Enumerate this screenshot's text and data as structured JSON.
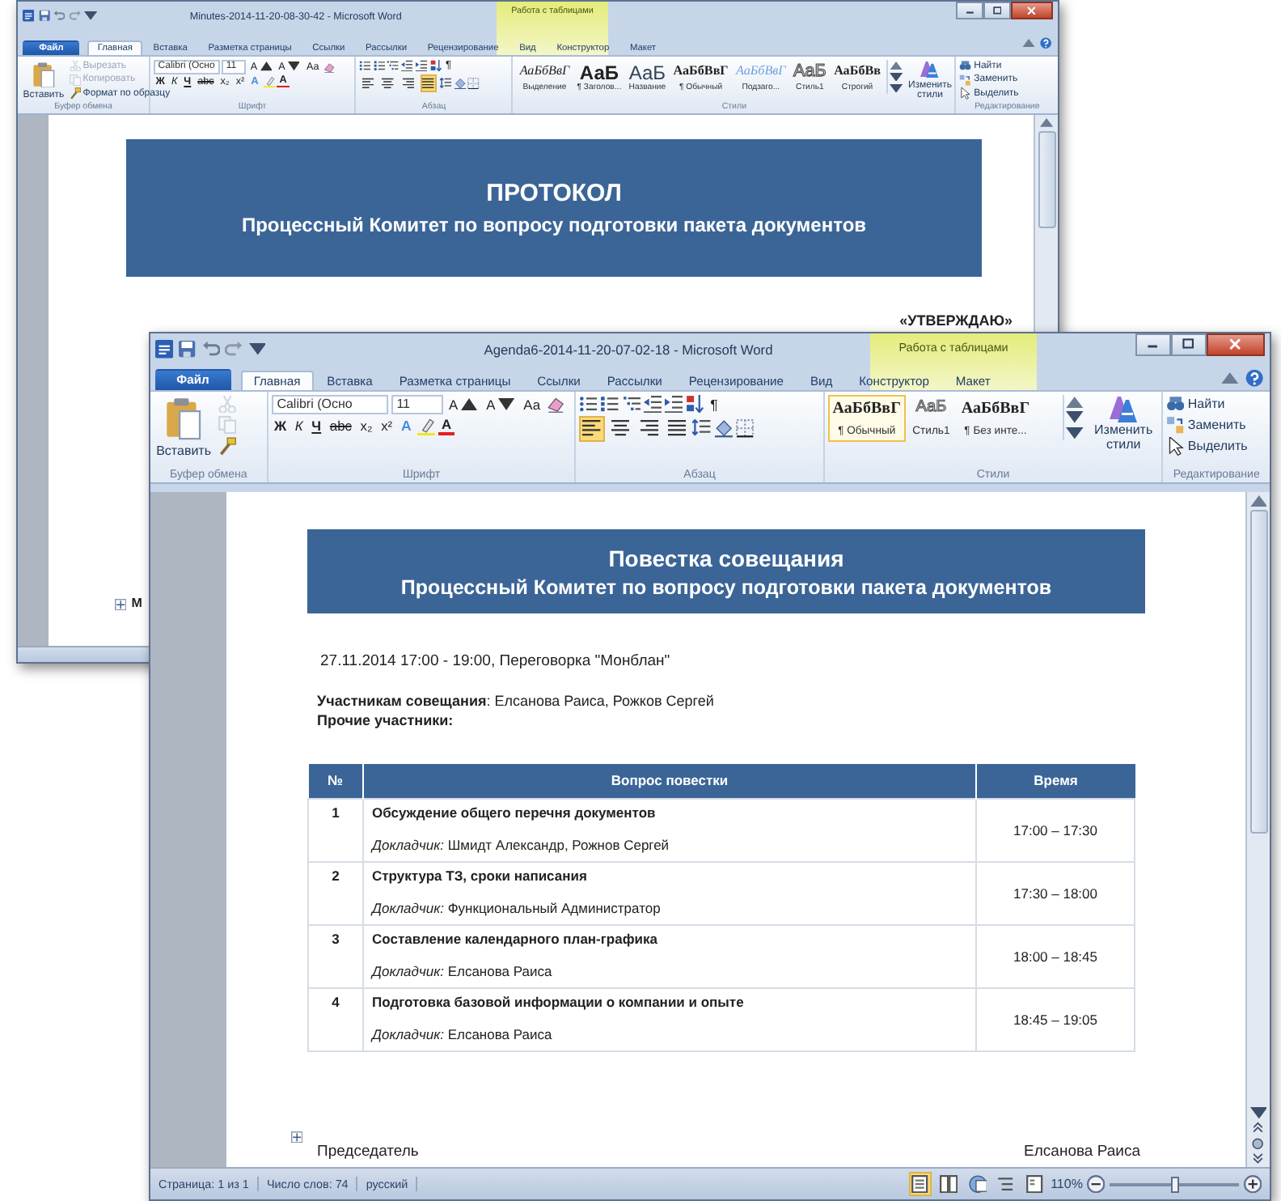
{
  "windows": [
    {
      "kind": "back",
      "title": "Minutes-2014-11-20-08-30-42 - Microsoft Word",
      "context_tab": "Работа с таблицами",
      "tabs": [
        {
          "label": "Файл",
          "kind": "file",
          "selected": false
        },
        {
          "label": "Главная",
          "kind": "tab",
          "selected": true
        },
        {
          "label": "Вставка",
          "kind": "tab",
          "selected": false
        },
        {
          "label": "Разметка страницы",
          "kind": "tab",
          "selected": false
        },
        {
          "label": "Ссылки",
          "kind": "tab",
          "selected": false
        },
        {
          "label": "Рассылки",
          "kind": "tab",
          "selected": false
        },
        {
          "label": "Рецензирование",
          "kind": "tab",
          "selected": false
        },
        {
          "label": "Вид",
          "kind": "tab",
          "selected": false
        },
        {
          "label": "Конструктор",
          "kind": "tab",
          "selected": false
        },
        {
          "label": "Макет",
          "kind": "tab",
          "selected": false
        }
      ],
      "ribbon": [
        {
          "kind": "clipboard",
          "label": "Буфер обмена",
          "paste": "Вставить",
          "small": [
            {
              "label": "Вырезать",
              "disabled": true
            },
            {
              "label": "Копировать",
              "disabled": true
            },
            {
              "label": "Формат по образцу",
              "disabled": false
            }
          ]
        },
        {
          "kind": "font",
          "label": "Шрифт",
          "font": "Calibri (Осно",
          "size": "11",
          "grow": "A",
          "shrink": "A",
          "case": "Аа",
          "format": [
            {
              "text": "Ж",
              "kind": "bold"
            },
            {
              "text": "К",
              "kind": "italic"
            },
            {
              "text": "Ч",
              "kind": "underline"
            },
            {
              "text": "abc",
              "kind": "strike"
            },
            {
              "text": "x₂",
              "kind": "sub"
            },
            {
              "text": "x²",
              "kind": "sup"
            }
          ],
          "effects": "A",
          "color_letter": "A"
        },
        {
          "kind": "paragraph",
          "label": "Абзац",
          "pilcrow": "¶",
          "align": [
            {
              "selected": false
            },
            {
              "selected": false
            },
            {
              "selected": false
            },
            {
              "selected": true
            }
          ]
        },
        {
          "kind": "styles",
          "label": "Стили",
          "change": "Изменить стили",
          "styles": [
            {
              "sample": "АаБбВвГ",
              "label": "Выделение",
              "kind": "italic",
              "selected": false
            },
            {
              "sample": "АаБ",
              "label": "¶ Заголов...",
              "kind": "heading",
              "selected": false
            },
            {
              "sample": "АаБ",
              "label": "Название",
              "kind": "title",
              "selected": false
            },
            {
              "sample": "АаБбВвГ",
              "label": "¶ Обычный",
              "kind": "serif",
              "selected": false
            },
            {
              "sample": "АаБбВвГ",
              "label": "Подзаго...",
              "kind": "subtle",
              "selected": false
            },
            {
              "sample": "АаБ",
              "label": "Стиль1",
              "kind": "outline",
              "selected": false
            },
            {
              "sample": "АаБбВв",
              "label": "Строгий",
              "kind": "strong",
              "selected": false
            }
          ]
        },
        {
          "kind": "editing",
          "label": "Редактирование",
          "items": [
            "Найти",
            "Заменить",
            "Выделить"
          ]
        }
      ],
      "document": {
        "banner": {
          "title": "ПРОТОКОЛ",
          "subtitle": "Процессный Комитет по вопросу подготовки пакета документов"
        },
        "approval": "«УТВЕРЖДАЮ»",
        "fragment": "М"
      }
    },
    {
      "kind": "front",
      "title": "Agenda6-2014-11-20-07-02-18 - Microsoft Word",
      "context_tab": "Работа с таблицами",
      "tabs": [
        {
          "label": "Файл",
          "kind": "file",
          "selected": false
        },
        {
          "label": "Главная",
          "kind": "tab",
          "selected": true
        },
        {
          "label": "Вставка",
          "kind": "tab",
          "selected": false
        },
        {
          "label": "Разметка страницы",
          "kind": "tab",
          "selected": false
        },
        {
          "label": "Ссылки",
          "kind": "tab",
          "selected": false
        },
        {
          "label": "Рассылки",
          "kind": "tab",
          "selected": false
        },
        {
          "label": "Рецензирование",
          "kind": "tab",
          "selected": false
        },
        {
          "label": "Вид",
          "kind": "tab",
          "selected": false
        },
        {
          "label": "Конструктор",
          "kind": "tab",
          "selected": false
        },
        {
          "label": "Макет",
          "kind": "tab",
          "selected": false
        }
      ],
      "ribbon": [
        {
          "kind": "clipboard",
          "label": "Буфер обмена",
          "paste": "Вставить",
          "small": [
            {
              "disabled": true
            },
            {
              "disabled": true
            },
            {
              "disabled": false
            }
          ]
        },
        {
          "kind": "font",
          "label": "Шрифт",
          "font": "Calibri (Осно",
          "size": "11",
          "grow": "A",
          "shrink": "A",
          "case": "Аа",
          "format": [
            {
              "text": "Ж",
              "kind": "bold"
            },
            {
              "text": "К",
              "kind": "italic"
            },
            {
              "text": "Ч",
              "kind": "underline"
            },
            {
              "text": "abc",
              "kind": "strike"
            },
            {
              "text": "x₂",
              "kind": "sub"
            },
            {
              "text": "x²",
              "kind": "sup"
            }
          ],
          "effects": "A",
          "color_letter": "A"
        },
        {
          "kind": "paragraph",
          "label": "Абзац",
          "pilcrow": "¶",
          "align": [
            {
              "selected": true
            },
            {
              "selected": false
            },
            {
              "selected": false
            },
            {
              "selected": false
            }
          ]
        },
        {
          "kind": "styles",
          "label": "Стили",
          "change": "Изменить стили",
          "styles": [
            {
              "sample": "АаБбВвГ",
              "label": "¶ Обычный",
              "kind": "serif",
              "selected": true
            },
            {
              "sample": "АаБ",
              "label": "Стиль1",
              "kind": "outline",
              "selected": false
            },
            {
              "sample": "АаБбВвГ",
              "label": "¶ Без инте...",
              "kind": "serif",
              "selected": false
            }
          ]
        },
        {
          "kind": "editing",
          "label": "Редактирование",
          "items": [
            "Найти",
            "Заменить",
            "Выделить"
          ]
        }
      ],
      "document": {
        "banner": {
          "title": "Повестка совещания",
          "subtitle": "Процессный Комитет по вопросу подготовки пакета документов"
        },
        "meeting_line": "27.11.2014 17:00 - 19:00, Переговорка \"Монблан\"",
        "participants": "**Участникам совещания**: Елсанова Раиса, Рожков Сергей",
        "others": "Прочие участники:",
        "table": {
          "columns": [
            "№",
            "Вопрос повестки",
            "Время"
          ],
          "rows": [
            {
              "number": "1",
              "topic": "Обсуждение общего перечня документов",
              "speaker": "*Докладчик:* Шмидт Александр, Рожнов  Сергей",
              "time": "17:00 – 17:30"
            },
            {
              "number": "2",
              "topic": "Структура ТЗ, сроки написания",
              "speaker": "*Докладчик:* Функциональный Администратор",
              "time": "17:30 – 18:00"
            },
            {
              "number": "3",
              "topic": "Составление календарного план-графика",
              "speaker": "*Докладчик:* Елсанова Раиса",
              "time": "18:00 – 18:45"
            },
            {
              "number": "4",
              "topic": "Подготовка базовой информации о компании и опыте",
              "speaker": "*Докладчик:* Елсанова Раиса",
              "time": "18:45 – 19:05"
            }
          ]
        },
        "signature": {
          "role": "Председатель",
          "name": "Елсанова Раиса"
        }
      },
      "status_bar": {
        "items": [
          "Страница: 1 из 1",
          "Число слов: 74",
          "русский"
        ],
        "views": [
          {
            "selected": true
          },
          {
            "selected": false
          },
          {
            "selected": false
          },
          {
            "selected": false
          },
          {
            "selected": false
          }
        ],
        "zoom": "110%",
        "zoom_level": {
          "level": 0.5
        }
      }
    }
  ]
}
